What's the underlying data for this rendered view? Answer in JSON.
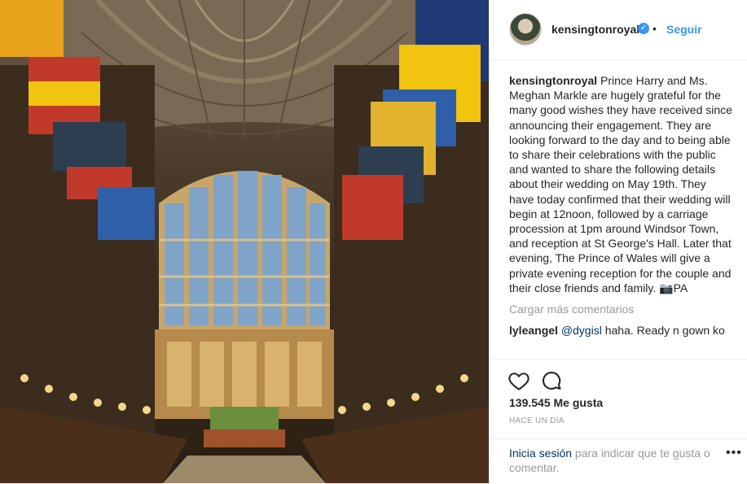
{
  "post": {
    "username": "kensingtonroyal",
    "follow_label": "Seguir",
    "separator": "•",
    "verified_glyph": "✓",
    "caption_user": "kensingtonroyal",
    "caption_text": " Prince Harry and Ms. Meghan Markle are hugely grateful for the many good wishes they have received since announcing their engagement. They are looking forward to the day and to being able to share their celebrations with the public and wanted to share the following details about their wedding on May 19th. They have today confirmed that their wedding will begin at 12noon, followed by a carriage procession at 1pm around Windsor Town, and reception at St George's Hall. Later that evening, The Prince of Wales will give a private evening reception for the couple and their close friends and family. 📷PA",
    "load_more": "Cargar más comentarios",
    "comments": [
      {
        "user": "lyleangel",
        "mention": "@dygisl",
        "text": " haha. Ready n gown ko"
      }
    ],
    "likes": "139.545 Me gusta",
    "timestamp": "HACE UN DÍA",
    "login_link": "Inicia sesión",
    "login_text": " para indicar que te gusta o comentar.",
    "more_options": "•••"
  },
  "icons": {
    "like": "heart-icon",
    "comment": "comment-bubble-icon",
    "verified": "verified-badge-icon"
  },
  "colors": {
    "link_blue": "#3897f0",
    "text": "#262626",
    "muted": "#999999",
    "mention": "#003569"
  }
}
